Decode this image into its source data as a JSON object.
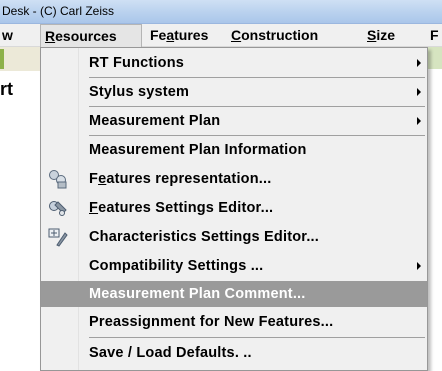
{
  "window": {
    "title": "Desk - (C) Carl Zeiss"
  },
  "menubar": {
    "items": [
      {
        "prefix": "",
        "mnemonic": "",
        "rest": "w"
      },
      {
        "prefix": "",
        "mnemonic": "R",
        "rest": "esources"
      },
      {
        "prefix": "Fe",
        "mnemonic": "a",
        "rest": "tures"
      },
      {
        "prefix": "",
        "mnemonic": "C",
        "rest": "onstruction"
      },
      {
        "prefix": "",
        "mnemonic": "S",
        "rest": "ize"
      },
      {
        "prefix": "F",
        "mnemonic": "",
        "rest": ""
      }
    ]
  },
  "background": {
    "partial_text": "rt"
  },
  "resources_menu": {
    "items": [
      {
        "label": "RT Functions",
        "submenu": true,
        "icon": ""
      },
      {
        "label": "Stylus system",
        "submenu": true,
        "icon": ""
      },
      {
        "label": "Measurement Plan",
        "submenu": true,
        "icon": ""
      },
      {
        "label": "Measurement Plan Information",
        "submenu": false,
        "icon": ""
      },
      {
        "label_prefix": "F",
        "label_mnemonic": "e",
        "label_rest": "atures representation...",
        "submenu": false,
        "icon": "features-representation-icon"
      },
      {
        "label_prefix": "",
        "label_mnemonic": "F",
        "label_rest": "eatures Settings Editor...",
        "submenu": false,
        "icon": "features-settings-icon"
      },
      {
        "label": "Characteristics Settings Editor...",
        "submenu": false,
        "icon": "characteristics-settings-icon"
      },
      {
        "label": "Compatibility Settings ...",
        "submenu": true,
        "icon": ""
      },
      {
        "label": "Measurement Plan Comment...",
        "submenu": false,
        "icon": "",
        "highlighted": true
      },
      {
        "label": "Preassignment for New Features...",
        "submenu": false,
        "icon": ""
      },
      {
        "label": "Save / Load Defaults. ..",
        "submenu": false,
        "icon": ""
      }
    ]
  },
  "colors": {
    "highlight": "#9a9a9a",
    "menu_background": "#f0f0f0",
    "titlebar": "#b9d1ee"
  }
}
